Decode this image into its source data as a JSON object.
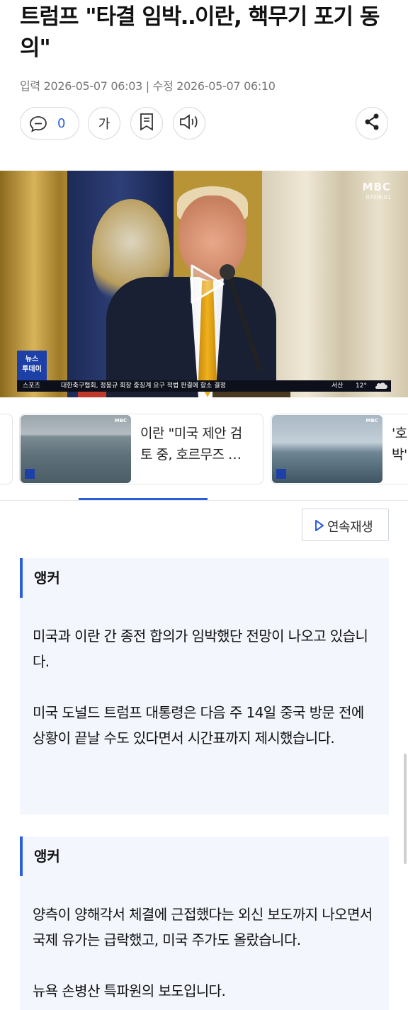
{
  "article": {
    "headline": "트럼프 \"타결 임박‥이란, 핵무기 포기 동의\"",
    "meta": "입력 2026-05-07 06:03 | 수정 2026-05-07 06:10",
    "comment_count": "0",
    "font_button": "가"
  },
  "video": {
    "channel_logo": "MBC",
    "channel_time": "07퇴6:01",
    "badge": "뉴스\n투데이",
    "ticker_section": "스포츠",
    "ticker_text": "대한축구협회, 정몽규 회장 중징계 요구 적법 판결에 항소 결정",
    "weather_location": "서산",
    "weather_temp": "12°"
  },
  "related": [
    {
      "title": "이란 \"미국 제안 검토 중, 호르무즈 …"
    },
    {
      "title": "'호 박'"
    }
  ],
  "autoplay_label": "연속재생",
  "transcript": [
    {
      "speaker": "앵커",
      "paragraphs": [
        "미국과 이란 간 종전 합의가 임박했단 전망이 나오고 있습니다.",
        "미국 도널드 트럼프 대통령은 다음 주 14일 중국 방문 전에 상황이 끝날 수도 있다면서 시간표까지 제시했습니다."
      ]
    },
    {
      "speaker": "앵커",
      "paragraphs": [
        "양측이 양해각서 체결에 근접했다는 외신 보도까지 나오면서 국제 유가는 급락했고, 미국 주가도 올랐습니다.",
        "뉴욕 손병산 특파원의 보도입니다."
      ]
    }
  ],
  "colors": {
    "accent": "#2b5fd9",
    "box_bg": "#f3f6fd"
  }
}
